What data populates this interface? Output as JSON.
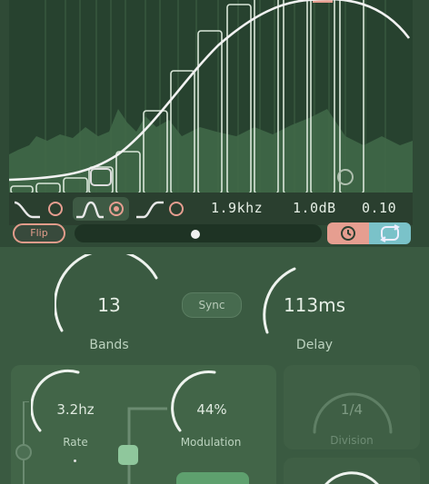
{
  "filter": {
    "frequency": "1.9khz",
    "gain": "1.0dB",
    "q": "0.10"
  },
  "controls": {
    "flip_label": "Flip",
    "slider_value": 0.49
  },
  "bands": {
    "value": "13",
    "label": "Bands"
  },
  "sync": {
    "label": "Sync"
  },
  "delay": {
    "value": "113ms",
    "label": "Delay"
  },
  "rate": {
    "value": "3.2hz",
    "label": "Rate"
  },
  "modulation": {
    "value": "44%",
    "label": "Modulation"
  },
  "division": {
    "value": "1/4",
    "label": "Division"
  },
  "colors": {
    "accent_salmon": "#e69e90",
    "accent_teal": "#7ac2c9",
    "panel": "#3a5a41"
  }
}
